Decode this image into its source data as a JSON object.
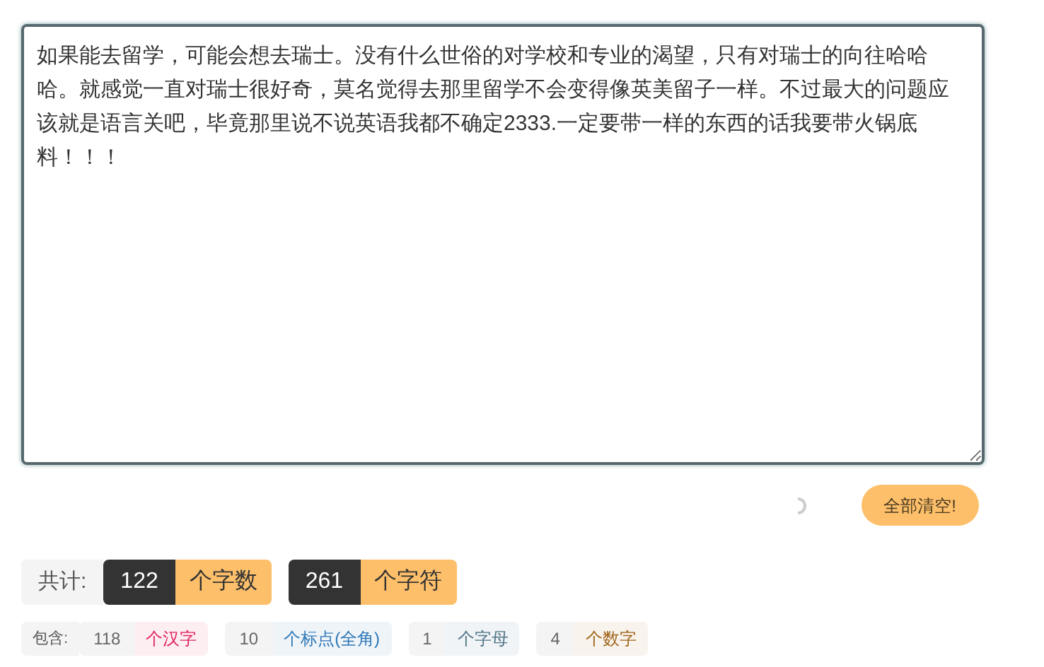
{
  "editor": {
    "value": "如果能去留学，可能会想去瑞士。没有什么世俗的对学校和专业的渴望，只有对瑞士的向往哈哈哈。就感觉一直对瑞士很好奇，莫名觉得去那里留学不会变得像英美留子一样。不过最大的问题应该就是语言关吧，毕竟那里说不说英语我都不确定2333.一定要带一样的东西的话我要带火锅底料！！！"
  },
  "clear_button": "全部清空!",
  "totals": {
    "label": "共计:",
    "items": [
      {
        "value": "122",
        "unit": "个字数"
      },
      {
        "value": "261",
        "unit": "个字符"
      }
    ]
  },
  "breakdown": {
    "label": "包含:",
    "items": [
      {
        "value": "118",
        "unit": "个汉字",
        "color": "#e0245e"
      },
      {
        "value": "10",
        "unit": "个标点(全角)",
        "color": "#2f78b7"
      },
      {
        "value": "1",
        "unit": "个字母",
        "color": "#4f7488"
      },
      {
        "value": "4",
        "unit": "个数字",
        "color": "#a0661a"
      }
    ]
  }
}
